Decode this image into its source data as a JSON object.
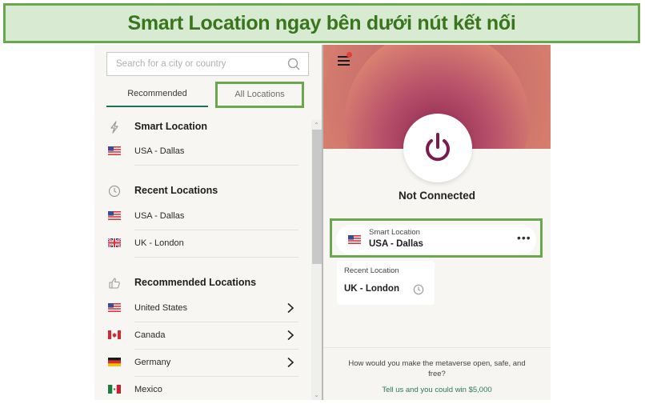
{
  "banner": {
    "text": "Smart Location ngay bên dưới nút kết nối"
  },
  "colors": {
    "highlight_border": "#6aa84f",
    "highlight_fill": "#d9ead3",
    "banner_text": "#38761d",
    "accent_green": "#1f6f5c",
    "power_icon": "#7a1b4d"
  },
  "search": {
    "placeholder": "Search for a city or country",
    "value": "",
    "icon": "search-icon"
  },
  "tabs": [
    {
      "label": "Recommended",
      "active": true
    },
    {
      "label": "All Locations",
      "active": false,
      "highlighted": true
    }
  ],
  "sections": {
    "smart": {
      "title": "Smart Location",
      "icon": "lightning-icon",
      "items": [
        {
          "label": "USA - Dallas",
          "flag": "us"
        }
      ]
    },
    "recent": {
      "title": "Recent Locations",
      "icon": "clock-icon",
      "items": [
        {
          "label": "USA - Dallas",
          "flag": "us"
        },
        {
          "label": "UK - London",
          "flag": "uk"
        }
      ]
    },
    "recommended": {
      "title": "Recommended Locations",
      "icon": "thumbs-up-icon",
      "items": [
        {
          "label": "United States",
          "flag": "us",
          "expandable": true
        },
        {
          "label": "Canada",
          "flag": "ca",
          "expandable": true
        },
        {
          "label": "Germany",
          "flag": "de",
          "expandable": true
        },
        {
          "label": "Mexico",
          "flag": "mx",
          "expandable": false
        }
      ]
    }
  },
  "main": {
    "status": "Not Connected",
    "menu_icon": "hamburger-menu-icon",
    "notification_dot": true,
    "smart_card": {
      "sublabel": "Smart Location",
      "location": "USA - Dallas",
      "flag": "us",
      "more": "•••"
    },
    "recent_card": {
      "sublabel": "Recent Location",
      "location": "UK - London"
    },
    "promo": {
      "question": "How would you make the metaverse open, safe, and free?",
      "link": "Tell us and you could win $5,000"
    }
  }
}
